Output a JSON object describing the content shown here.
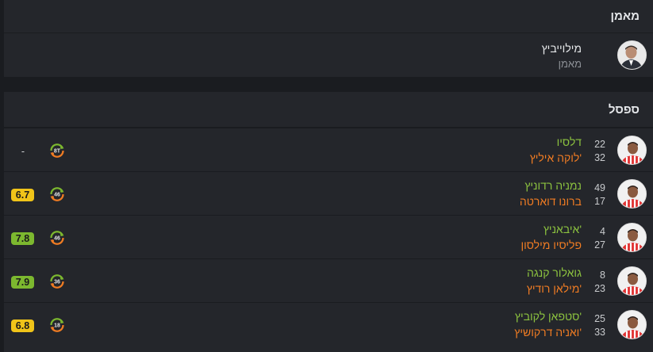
{
  "coach": {
    "title": "מאמן",
    "name": "מילוייביץ",
    "role": "מאמן"
  },
  "bench": {
    "title": "ספסל",
    "rows": [
      {
        "in_number": "22",
        "out_number": "32",
        "in_name": "דלסיו",
        "out_name": "'לוקה איליץ",
        "minute": "8T",
        "rating": "-",
        "rating_color": ""
      },
      {
        "in_number": "49",
        "out_number": "17",
        "in_name": "נמניה רדוניץ",
        "out_name": "ברונו דוארטה",
        "minute": "46",
        "rating": "6.7",
        "rating_color": "#f0c419"
      },
      {
        "in_number": "4",
        "out_number": "27",
        "in_name": "'איבאניץ",
        "out_name": "פליסיו מילסון",
        "minute": "46",
        "rating": "7.8",
        "rating_color": "#7cb82f"
      },
      {
        "in_number": "8",
        "out_number": "23",
        "in_name": "גואלור קנגה",
        "out_name": "'מילאן רודיץ",
        "minute": "36",
        "rating": "7.9",
        "rating_color": "#7cb82f"
      },
      {
        "in_number": "25",
        "out_number": "33",
        "in_name": "'סטפאן לקוביץ",
        "out_name": "'ואניה דרקושיץ",
        "minute": "18",
        "rating": "6.8",
        "rating_color": "#f0c419"
      }
    ]
  },
  "colors": {
    "in": "#8cc23f",
    "out": "#f07c23",
    "icon_arrow_in": "#7cb82f",
    "icon_arrow_out": "#f07c23"
  }
}
